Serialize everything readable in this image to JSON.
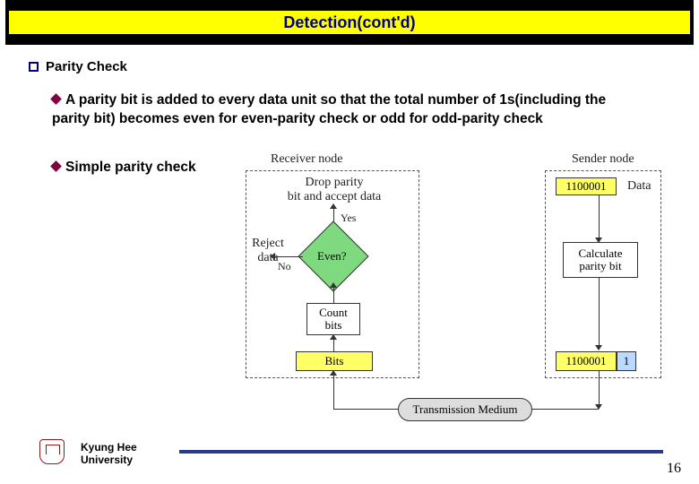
{
  "title": "Detection(cont'd)",
  "bullets": {
    "parity_check": "Parity Check",
    "desc": "A parity bit is added to every data unit so that the total number of 1s(including the parity bit) becomes even for even-parity check or odd for odd-parity check",
    "simple": "Simple parity check"
  },
  "diagram": {
    "receiver_label": "Receiver node",
    "sender_label": "Sender node",
    "drop_parity": "Drop parity\nbit and accept data",
    "reject": "Reject\ndata",
    "even": "Even?",
    "yes": "Yes",
    "no": "No",
    "count_bits": "Count\nbits",
    "bits": "Bits",
    "calc": "Calculate\nparity bit",
    "sender_data_bits": "1100001",
    "sender_data_label": "Data",
    "sender_out_bits": "1100001",
    "sender_out_parity": "1",
    "tm": "Transmission Medium"
  },
  "footer": {
    "uni1": "Kyung Hee",
    "uni2": "University",
    "page": "16"
  }
}
